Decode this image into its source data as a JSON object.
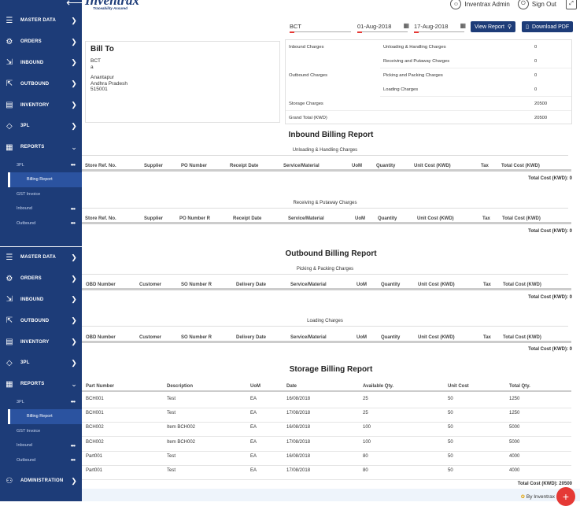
{
  "app": {
    "logo": "Inventrax",
    "tagline": "Traceability Assured",
    "user": "Inventrax Admin",
    "signout": "Sign Out"
  },
  "sidebar": {
    "items": [
      "MASTER DATA",
      "ORDERS",
      "INBOUND",
      "OUTBOUND",
      "INVENTORY",
      "3PL",
      "REPORTS"
    ],
    "sub": {
      "section": "3PL",
      "billing": "Billing Report",
      "gst": "GST Invoice",
      "inbound": "Inbound",
      "outbound": "Outbound"
    },
    "admin": "ADMINISTRATION"
  },
  "filters": {
    "client": "BCT",
    "from": "01-Aug-2018",
    "to": "17-Aug-2018",
    "view_label": "View Report",
    "pdf_label": "Download PDF"
  },
  "billto": {
    "title": "Bill To",
    "name": "BCT",
    "line2": "a",
    "city": "Anantapur",
    "state": "Andhra Pradesh",
    "zip": "515001"
  },
  "charges": {
    "inbound": "Inbound Charges",
    "unloading": "Unloading & Handling Charges",
    "unloading_v": "0",
    "receiving": "Receiving and Putaway Charges",
    "receiving_v": "0",
    "outbound": "Outbound Charges",
    "picking": "Picking and Packing Charges",
    "picking_v": "0",
    "loading": "Loading Charges",
    "loading_v": "0",
    "storage": "Storage Charges",
    "storage_v": "20500",
    "grand": "Grand Total (KWD)",
    "grand_v": "20500"
  },
  "inbound_report": {
    "title": "Inbound Billing Report",
    "sec1": "Unloading & Handling Charges",
    "sec2": "Receiving & Putaway Charges",
    "cols": [
      "Store Ref. No.",
      "Supplier",
      "PO Number",
      "Receipt Date",
      "Service/Material",
      "UoM",
      "Quantity",
      "Unit Cost (KWD)",
      "Tax",
      "Total Cost (KWD)"
    ],
    "cols2": [
      "Store Ref. No.",
      "Supplier",
      "PO Number R",
      "Receipt Date",
      "Service/Material",
      "UoM",
      "Quantity",
      "Unit Cost (KWD)",
      "Tax",
      "Total Cost (KWD)"
    ],
    "total": "Total Cost (KWD): 0"
  },
  "outbound_report": {
    "title": "Outbound Billing Report",
    "sec1": "Picking & Packing Charges",
    "sec2": "Loading Charges",
    "cols": [
      "OBD Number",
      "Customer",
      "SO Number R",
      "Delivery Date",
      "Service/Material",
      "UoM",
      "Quantity",
      "Unit Cost (KWD)",
      "Tax",
      "Total Cost (KWD)"
    ],
    "total": "Total Cost (KWD): 0"
  },
  "storage_report": {
    "title": "Storage Billing Report",
    "cols": [
      "Part Number",
      "Description",
      "UoM",
      "Date",
      "Available Qty.",
      "Unit Cost",
      "Total Qty."
    ],
    "rows": [
      [
        "BCH001",
        "Test",
        "EA",
        "16/08/2018",
        "25",
        "50",
        "1250"
      ],
      [
        "BCH001",
        "Test",
        "EA",
        "17/08/2018",
        "25",
        "50",
        "1250"
      ],
      [
        "BCH002",
        "Item BCH002",
        "EA",
        "16/08/2018",
        "100",
        "50",
        "5000"
      ],
      [
        "BCH002",
        "Item BCH002",
        "EA",
        "17/08/2018",
        "100",
        "50",
        "5000"
      ],
      [
        "Part001",
        "Test",
        "EA",
        "16/08/2018",
        "80",
        "50",
        "4000"
      ],
      [
        "Part001",
        "Test",
        "EA",
        "17/08/2018",
        "80",
        "50",
        "4000"
      ]
    ],
    "total": "Total Cost (KWD): 20500"
  },
  "footer": {
    "by": "By Inventrax"
  }
}
